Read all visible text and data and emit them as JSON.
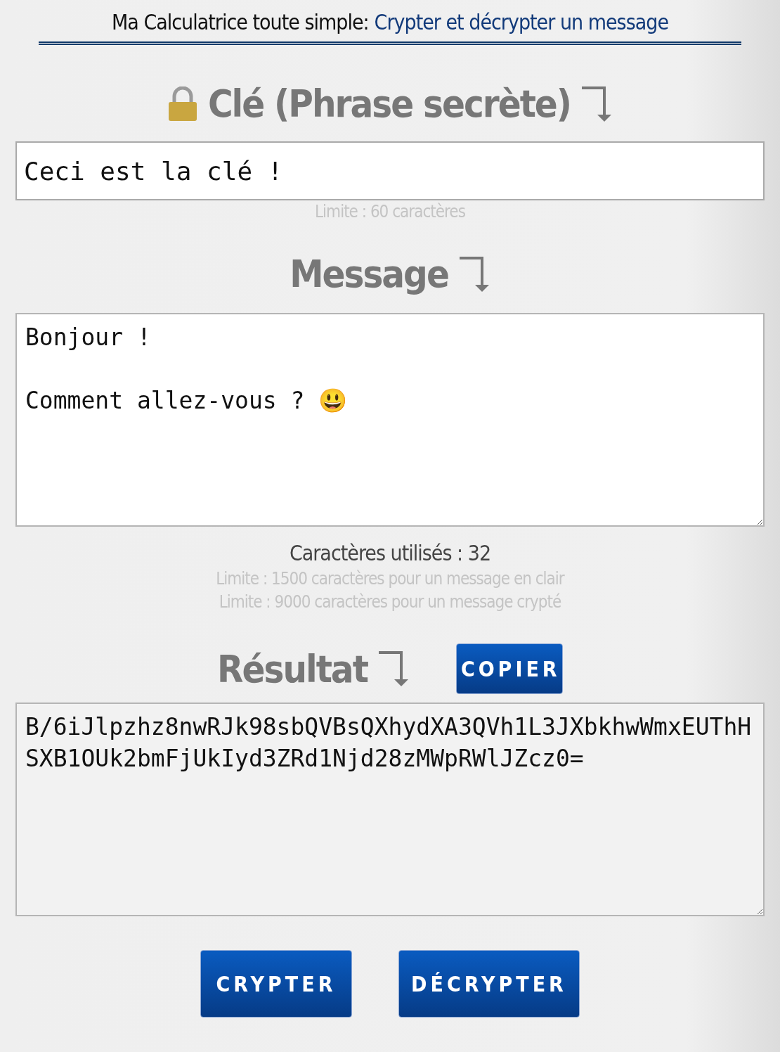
{
  "header": {
    "title": "Ma Calculatrice toute simple:",
    "subtitle": "Crypter et décrypter un message"
  },
  "key": {
    "heading": "Clé (Phrase secrète)",
    "value": "Ceci est la clé !",
    "limit": "Limite : 60 caractères"
  },
  "message": {
    "heading": "Message",
    "value": "Bonjour !\n\nComment allez-vous ? 😃",
    "count": "Caractères utilisés : 32",
    "limits": [
      "Limite : 1500 caractères pour un message en clair",
      "Limite : 9000 caractères pour un message crypté"
    ]
  },
  "result": {
    "heading": "Résultat",
    "copy_button": "COPIER",
    "value": "B/6iJlpzhz8nwRJk98sbQVBsQXhydXA3QVh1L3JXbkhwWmxEUThHSXB1OUk2bmFjUkIyd3ZRd1Njd28zMWpRWlJZcz0="
  },
  "buttons": [
    "CRYPTER",
    "DÉCRYPTER"
  ]
}
